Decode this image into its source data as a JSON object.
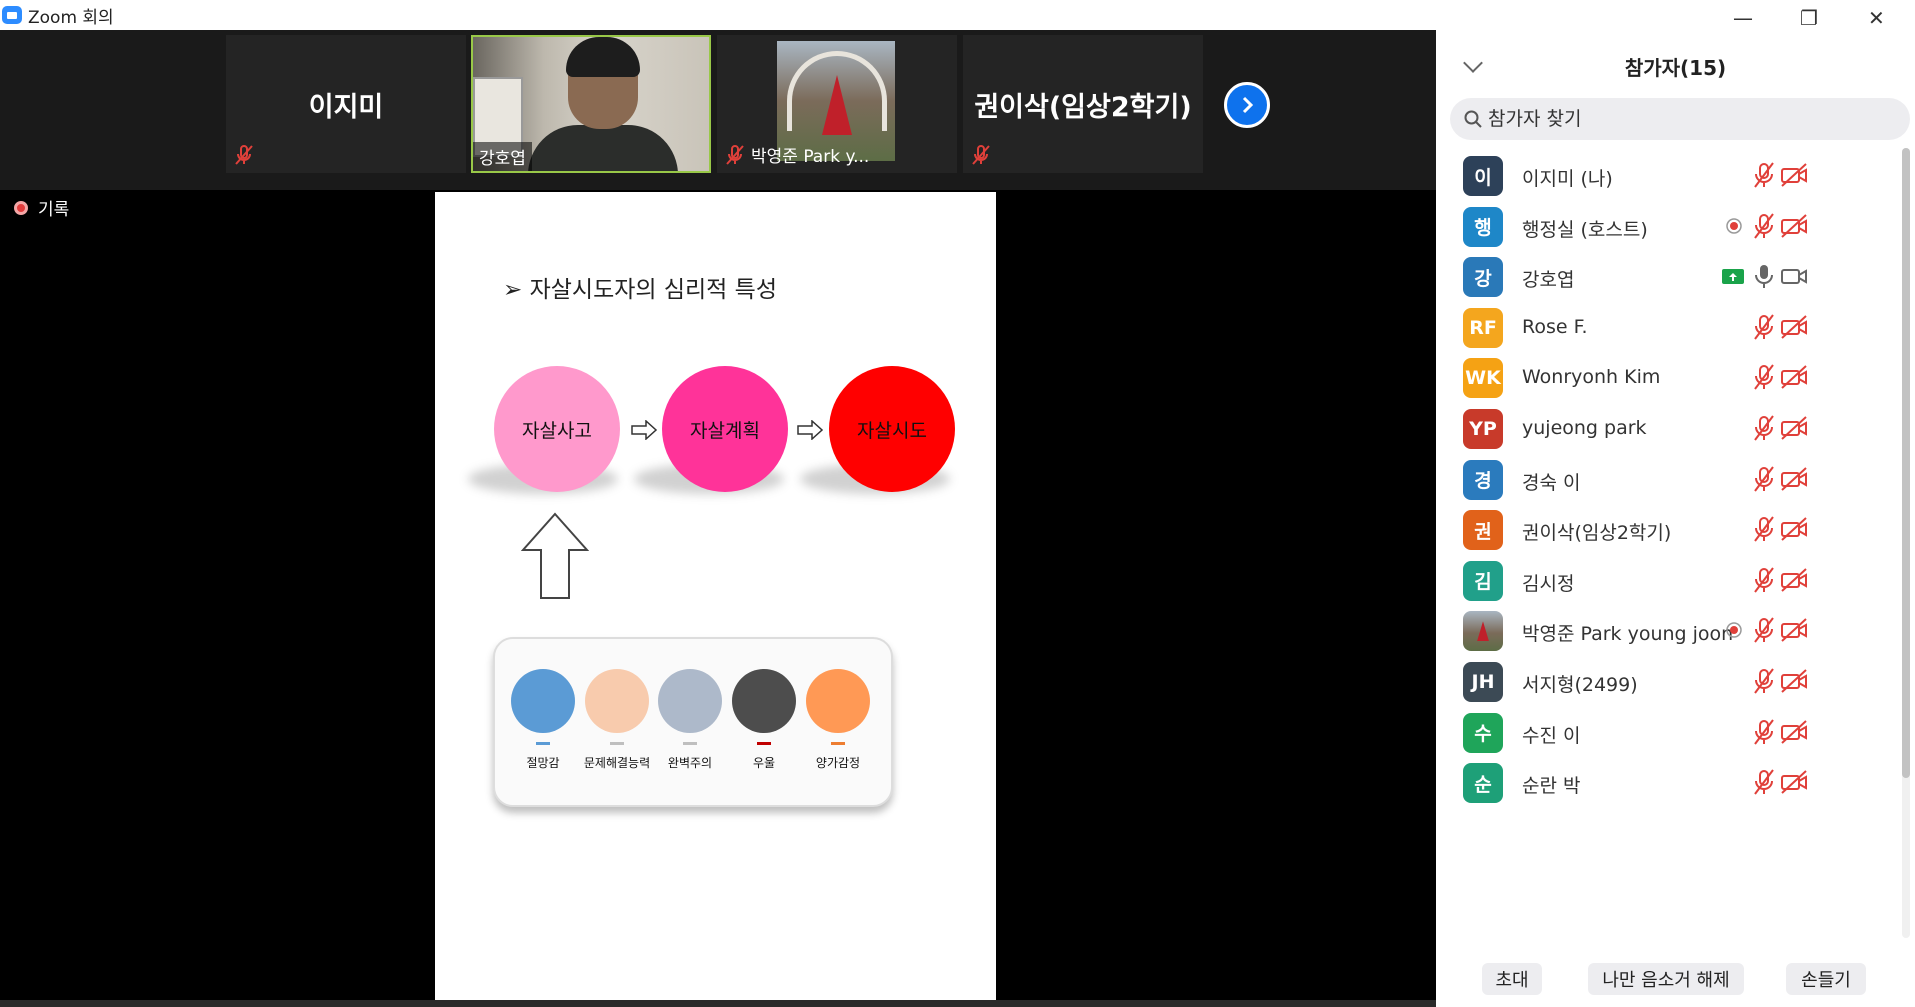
{
  "window": {
    "title": "Zoom 회의",
    "controls": {
      "minimize": "—",
      "restore": "❐",
      "close": "✕"
    }
  },
  "gallery": {
    "tiles": [
      {
        "name": "이지미"
      },
      {
        "name": "강호엽"
      },
      {
        "name": "박영준 Park y..."
      },
      {
        "name": "권이삭(임상2학기)"
      }
    ]
  },
  "recording": {
    "label": "기록"
  },
  "slide": {
    "heading": "자살시도자의 심리적 특성",
    "bullet": "➢",
    "stages": [
      {
        "label": "자살사고",
        "color": "#ff99cc"
      },
      {
        "label": "자살계획",
        "color": "#ff3399"
      },
      {
        "label": "자살시도",
        "color": "#ff0000"
      }
    ],
    "factors": [
      {
        "label": "절망감",
        "color": "#5b9bd5",
        "dash": "#5b9bd5"
      },
      {
        "label": "문제해결능력",
        "color": "#f8cbad",
        "dash": "#bfbfbf"
      },
      {
        "label": "완벽주의",
        "color": "#adb9ca",
        "dash": "#bfbfbf"
      },
      {
        "label": "우울",
        "color": "#4d4d4d",
        "dash": "#c00000"
      },
      {
        "label": "양가감정",
        "color": "#ff9955",
        "dash": "#ed7d31"
      }
    ]
  },
  "panel": {
    "title": "참가자(15)",
    "search": {
      "placeholder": "참가자 찾기"
    },
    "participants": [
      {
        "initial": "이",
        "color": "#2d4159",
        "name": "이지미 (나)",
        "rec": false,
        "mic": "off",
        "cam": "off"
      },
      {
        "initial": "행",
        "color": "#1e87c8",
        "name": "행정실 (호스트)",
        "rec": true,
        "mic": "off",
        "cam": "off"
      },
      {
        "initial": "강",
        "color": "#2a79b8",
        "name": "강호엽",
        "rec": false,
        "mic": "on",
        "cam": "on",
        "share": true
      },
      {
        "initial": "RF",
        "color": "#f4a61e",
        "name": "Rose F.",
        "rec": false,
        "mic": "off",
        "cam": "off"
      },
      {
        "initial": "WK",
        "color": "#f5a214",
        "name": "Wonryonh Kim",
        "rec": false,
        "mic": "off",
        "cam": "off"
      },
      {
        "initial": "YP",
        "color": "#c83a2a",
        "name": "yujeong park",
        "rec": false,
        "mic": "off",
        "cam": "off"
      },
      {
        "initial": "경",
        "color": "#2b7bbd",
        "name": "경숙 이",
        "rec": false,
        "mic": "off",
        "cam": "off"
      },
      {
        "initial": "권",
        "color": "#e1621a",
        "name": "권이삭(임상2학기)",
        "rec": false,
        "mic": "off",
        "cam": "off"
      },
      {
        "initial": "김",
        "color": "#21a08a",
        "name": "김시정",
        "rec": false,
        "mic": "off",
        "cam": "off"
      },
      {
        "initial": "",
        "color": "#8a7a60",
        "name": "박영준 Park young joon",
        "rec": true,
        "mic": "off",
        "cam": "off",
        "photo": true
      },
      {
        "initial": "JH",
        "color": "#3c4a55",
        "name": "서지형(2499)",
        "rec": false,
        "mic": "off",
        "cam": "off"
      },
      {
        "initial": "수",
        "color": "#1fa55a",
        "name": "수진 이",
        "rec": false,
        "mic": "off",
        "cam": "off"
      },
      {
        "initial": "순",
        "color": "#1ea078",
        "name": "순란 박",
        "rec": false,
        "mic": "off",
        "cam": "off"
      }
    ],
    "buttons": {
      "invite": "초대",
      "unmute": "나만 음소거 해제",
      "raise": "손들기"
    }
  }
}
